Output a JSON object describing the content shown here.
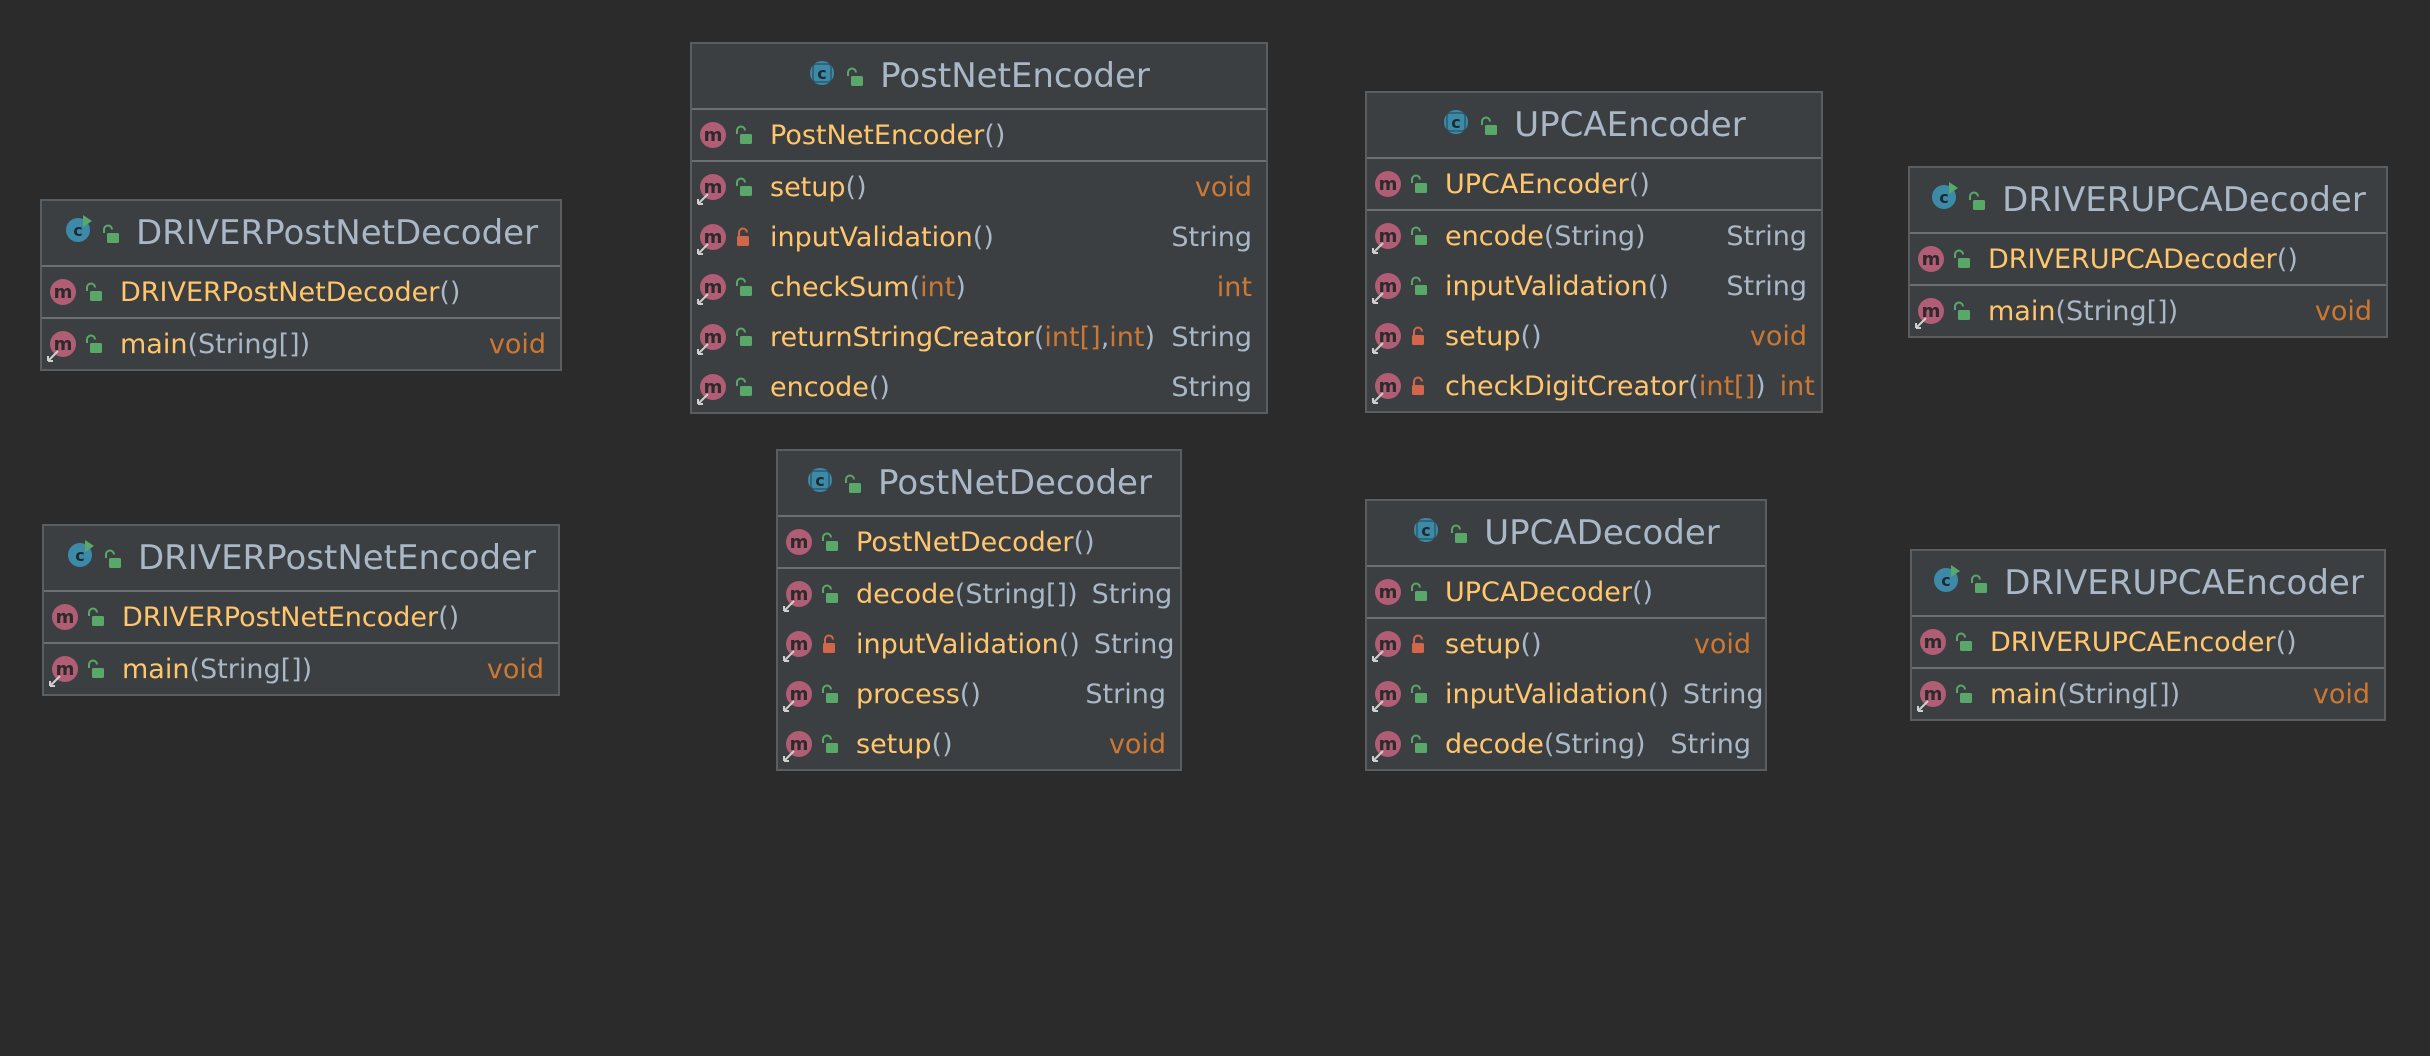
{
  "colors": {
    "background": "#2b2b2b",
    "box_fill": "#3c3f41",
    "class_name": "#a9b7c6",
    "method_name": "#ffc66d",
    "primitive_type": "#cc7832",
    "method_icon": "#b05d75",
    "class_icon": "#3d8aa8",
    "public_lock": "#59a869",
    "private_lock": "#d2664a"
  },
  "classes": [
    {
      "name": "PostNetEncoder",
      "icon": "class-icon",
      "members": [
        {
          "name": "PostNetEncoder",
          "params": [],
          "ret": "",
          "vis": "public",
          "ctor": true
        },
        {
          "name": "setup",
          "params": [],
          "ret": "void",
          "vis": "public"
        },
        {
          "name": "inputValidation",
          "params": [],
          "ret": "String",
          "vis": "private"
        },
        {
          "name": "checkSum",
          "params": [
            "int"
          ],
          "ret": "int",
          "vis": "public"
        },
        {
          "name": "returnStringCreator",
          "params": [
            "int[]",
            "int"
          ],
          "ret": "String",
          "vis": "public"
        },
        {
          "name": "encode",
          "params": [],
          "ret": "String",
          "vis": "public"
        }
      ]
    },
    {
      "name": "UPCAEncoder",
      "icon": "class-icon",
      "members": [
        {
          "name": "UPCAEncoder",
          "params": [],
          "ret": "",
          "vis": "public",
          "ctor": true
        },
        {
          "name": "encode",
          "params": [
            "String"
          ],
          "ret": "String",
          "vis": "public"
        },
        {
          "name": "inputValidation",
          "params": [],
          "ret": "String",
          "vis": "public"
        },
        {
          "name": "setup",
          "params": [],
          "ret": "void",
          "vis": "private"
        },
        {
          "name": "checkDigitCreator",
          "params": [
            "int[]"
          ],
          "ret": "int",
          "vis": "private"
        }
      ]
    },
    {
      "name": "DRIVERPostNetDecoder",
      "icon": "runnable-class-icon",
      "members": [
        {
          "name": "DRIVERPostNetDecoder",
          "params": [],
          "ret": "",
          "vis": "public",
          "ctor": true
        },
        {
          "name": "main",
          "params": [
            "String[]"
          ],
          "ret": "void",
          "vis": "public"
        }
      ]
    },
    {
      "name": "DRIVERUPCADecoder",
      "icon": "runnable-class-icon",
      "members": [
        {
          "name": "DRIVERUPCADecoder",
          "params": [],
          "ret": "",
          "vis": "public",
          "ctor": true
        },
        {
          "name": "main",
          "params": [
            "String[]"
          ],
          "ret": "void",
          "vis": "public"
        }
      ]
    },
    {
      "name": "PostNetDecoder",
      "icon": "class-icon",
      "members": [
        {
          "name": "PostNetDecoder",
          "params": [],
          "ret": "",
          "vis": "public",
          "ctor": true
        },
        {
          "name": "decode",
          "params": [
            "String[]"
          ],
          "ret": "String",
          "vis": "public"
        },
        {
          "name": "inputValidation",
          "params": [],
          "ret": "String",
          "vis": "private"
        },
        {
          "name": "process",
          "params": [],
          "ret": "String",
          "vis": "public"
        },
        {
          "name": "setup",
          "params": [],
          "ret": "void",
          "vis": "public"
        }
      ]
    },
    {
      "name": "UPCADecoder",
      "icon": "class-icon",
      "members": [
        {
          "name": "UPCADecoder",
          "params": [],
          "ret": "",
          "vis": "public",
          "ctor": true
        },
        {
          "name": "setup",
          "params": [],
          "ret": "void",
          "vis": "private"
        },
        {
          "name": "inputValidation",
          "params": [],
          "ret": "String",
          "vis": "public"
        },
        {
          "name": "decode",
          "params": [
            "String"
          ],
          "ret": "String",
          "vis": "public"
        }
      ]
    },
    {
      "name": "DRIVERPostNetEncoder",
      "icon": "runnable-class-icon",
      "members": [
        {
          "name": "DRIVERPostNetEncoder",
          "params": [],
          "ret": "",
          "vis": "public",
          "ctor": true
        },
        {
          "name": "main",
          "params": [
            "String[]"
          ],
          "ret": "void",
          "vis": "public"
        }
      ]
    },
    {
      "name": "DRIVERUPCAEncoder",
      "icon": "runnable-class-icon",
      "members": [
        {
          "name": "DRIVERUPCAEncoder",
          "params": [],
          "ret": "",
          "vis": "public",
          "ctor": true
        },
        {
          "name": "main",
          "params": [
            "String[]"
          ],
          "ret": "void",
          "vis": "public"
        }
      ]
    }
  ]
}
